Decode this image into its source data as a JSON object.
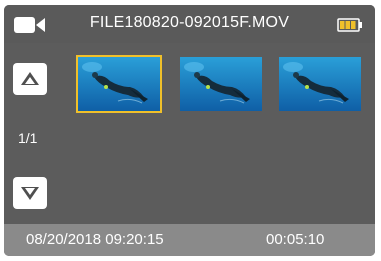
{
  "header": {
    "filename": "FILE180820-092015F.MOV",
    "mode_icon": "video-camera-icon",
    "battery_icon": "battery-icon",
    "battery_level": 0.75
  },
  "nav": {
    "page_indicator": "1/1",
    "up_icon": "chevron-up-icon",
    "down_icon": "chevron-down-icon"
  },
  "thumbnails": {
    "items": [
      {
        "selected": true
      },
      {
        "selected": false
      },
      {
        "selected": false
      }
    ]
  },
  "footer": {
    "datetime": "08/20/2018 09:20:15",
    "duration": "00:05:10"
  },
  "colors": {
    "background": "#5c5c5c",
    "footer": "#8a8a8a",
    "selection": "#f0c02a",
    "battery": "#f0c02a"
  }
}
